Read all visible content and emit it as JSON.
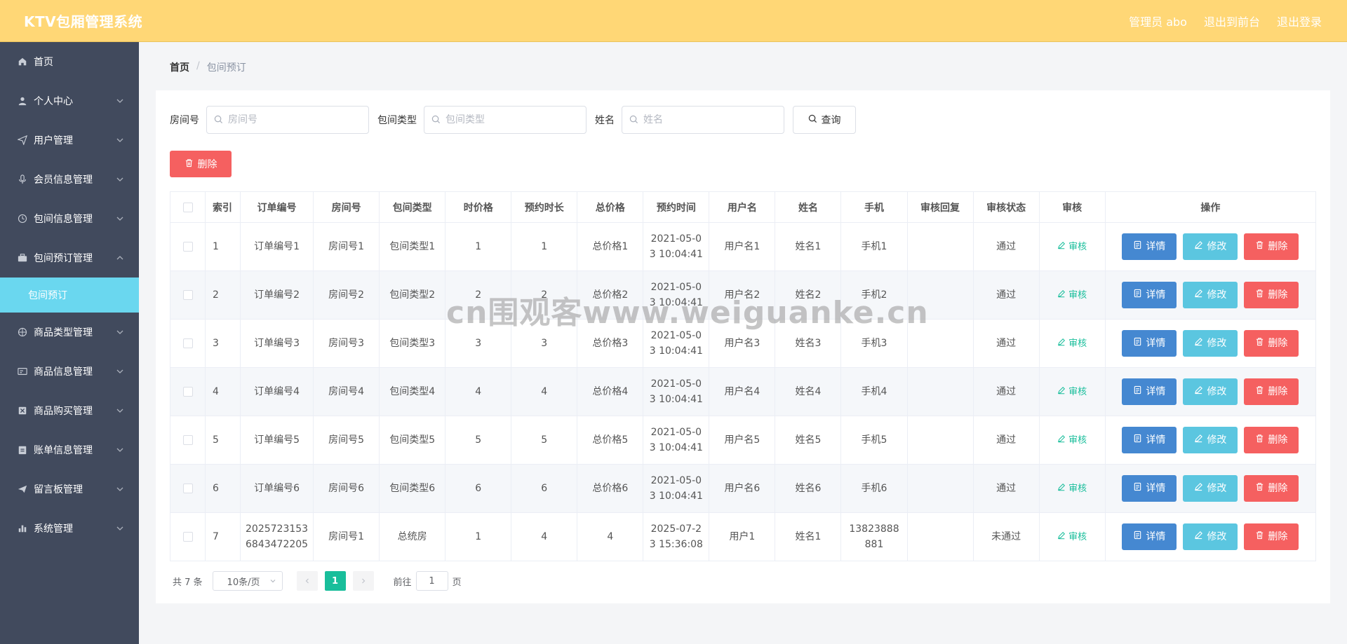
{
  "header": {
    "title": "KTV包厢管理系统",
    "admin_label": "管理员 abo",
    "to_front_label": "退出到前台",
    "logout_label": "退出登录"
  },
  "sidebar": {
    "items": [
      {
        "label": "首页",
        "icon": "home-icon"
      },
      {
        "label": "个人中心",
        "icon": "user-icon"
      },
      {
        "label": "用户管理",
        "icon": "send-icon"
      },
      {
        "label": "会员信息管理",
        "icon": "microphone-icon"
      },
      {
        "label": "包间信息管理",
        "icon": "clock-icon"
      },
      {
        "label": "包间预订管理",
        "icon": "briefcase-icon",
        "open": true
      },
      {
        "label": "商品类型管理",
        "icon": "globe-icon"
      },
      {
        "label": "商品信息管理",
        "icon": "card-icon"
      },
      {
        "label": "商品购买管理",
        "icon": "delete-box-icon"
      },
      {
        "label": "账单信息管理",
        "icon": "clipboard-icon"
      },
      {
        "label": "留言板管理",
        "icon": "paper-plane-icon"
      },
      {
        "label": "系统管理",
        "icon": "bar-chart-icon"
      }
    ],
    "active_sub": "包间预订"
  },
  "breadcrumb": {
    "home": "首页",
    "sep": "/",
    "current": "包间预订"
  },
  "search": {
    "room_label": "房间号",
    "room_placeholder": "房间号",
    "type_label": "包间类型",
    "type_placeholder": "包间类型",
    "name_label": "姓名",
    "name_placeholder": "姓名",
    "query_label": "查询"
  },
  "batch_delete_label": "删除",
  "table": {
    "headers": [
      "索引",
      "订单编号",
      "房间号",
      "包间类型",
      "时价格",
      "预约时长",
      "总价格",
      "预约时间",
      "用户名",
      "姓名",
      "手机",
      "审核回复",
      "审核状态",
      "审核",
      "操作"
    ],
    "rows": [
      {
        "idx": "1",
        "order": "订单编号1",
        "room": "房间号1",
        "type": "包间类型1",
        "price": "1",
        "duration": "1",
        "total": "总价格1",
        "time_a": "2021-05-0",
        "time_b": "3 10:04:41",
        "user": "用户名1",
        "name": "姓名1",
        "phone_a": "手机1",
        "phone_b": "",
        "reply": "",
        "status": "通过"
      },
      {
        "idx": "2",
        "order": "订单编号2",
        "room": "房间号2",
        "type": "包间类型2",
        "price": "2",
        "duration": "2",
        "total": "总价格2",
        "time_a": "2021-05-0",
        "time_b": "3 10:04:41",
        "user": "用户名2",
        "name": "姓名2",
        "phone_a": "手机2",
        "phone_b": "",
        "reply": "",
        "status": "通过"
      },
      {
        "idx": "3",
        "order": "订单编号3",
        "room": "房间号3",
        "type": "包间类型3",
        "price": "3",
        "duration": "3",
        "total": "总价格3",
        "time_a": "2021-05-0",
        "time_b": "3 10:04:41",
        "user": "用户名3",
        "name": "姓名3",
        "phone_a": "手机3",
        "phone_b": "",
        "reply": "",
        "status": "通过"
      },
      {
        "idx": "4",
        "order": "订单编号4",
        "room": "房间号4",
        "type": "包间类型4",
        "price": "4",
        "duration": "4",
        "total": "总价格4",
        "time_a": "2021-05-0",
        "time_b": "3 10:04:41",
        "user": "用户名4",
        "name": "姓名4",
        "phone_a": "手机4",
        "phone_b": "",
        "reply": "",
        "status": "通过"
      },
      {
        "idx": "5",
        "order": "订单编号5",
        "room": "房间号5",
        "type": "包间类型5",
        "price": "5",
        "duration": "5",
        "total": "总价格5",
        "time_a": "2021-05-0",
        "time_b": "3 10:04:41",
        "user": "用户名5",
        "name": "姓名5",
        "phone_a": "手机5",
        "phone_b": "",
        "reply": "",
        "status": "通过"
      },
      {
        "idx": "6",
        "order": "订单编号6",
        "room": "房间号6",
        "type": "包间类型6",
        "price": "6",
        "duration": "6",
        "total": "总价格6",
        "time_a": "2021-05-0",
        "time_b": "3 10:04:41",
        "user": "用户名6",
        "name": "姓名6",
        "phone_a": "手机6",
        "phone_b": "",
        "reply": "",
        "status": "通过"
      },
      {
        "idx": "7",
        "order_a": "2025723153",
        "order_b": "6843472205",
        "room": "房间号1",
        "type": "总统房",
        "price": "1",
        "duration": "4",
        "total": "4",
        "time_a": "2025-07-2",
        "time_b": "3 15:36:08",
        "user": "用户1",
        "name": "姓名1",
        "phone_a": "13823888",
        "phone_b": "881",
        "reply": "",
        "status": "未通过"
      }
    ],
    "audit_label": "审核",
    "detail_label": "详情",
    "edit_label": "修改",
    "delete_label": "删除"
  },
  "pagination": {
    "total": "共 7 条",
    "page_size": "10条/页",
    "current_page": "1",
    "goto_prefix": "前往",
    "goto_value": "1",
    "goto_suffix": "页"
  },
  "watermark": "cn围观客www.weiguanke.cn",
  "colors": {
    "header_bg": "#ffd776",
    "sidebar_bg": "#414a5d",
    "sidebar_active": "#6ad7ef",
    "primary_green": "#19be9b",
    "danger": "#f56060",
    "info_blue": "#4588d1",
    "edit_cyan": "#5bc6e0"
  }
}
